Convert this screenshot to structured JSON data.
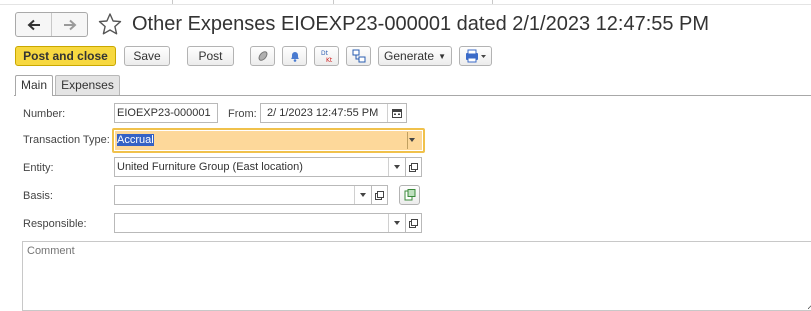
{
  "window": {
    "title": "Other Expenses EIOEXP23-000001 dated 2/1/2023 12:47:55 PM"
  },
  "nav": {
    "back_icon": "arrow-left-icon",
    "forward_icon": "arrow-right-icon",
    "favorite_icon": "star-icon"
  },
  "toolbar": {
    "post_close_label": "Post and close",
    "save_label": "Save",
    "post_label": "Post",
    "generate_label": "Generate",
    "icons": [
      "paperclip-icon",
      "bell-icon",
      "debit-credit-icon",
      "structure-icon",
      "print-icon"
    ],
    "accent_color": "#f7d840"
  },
  "tabs": [
    {
      "label": "Main",
      "active": true
    },
    {
      "label": "Expenses",
      "active": false
    }
  ],
  "form": {
    "number_label": "Number:",
    "number_value": "EIOEXP23-000001",
    "from_label": "From:",
    "from_value": "2/ 1/2023 12:47:55 PM",
    "transaction_type_label": "Transaction Type:",
    "transaction_type_value": "Accrual",
    "entity_label": "Entity:",
    "entity_value": "United Furniture Group (East location)",
    "basis_label": "Basis:",
    "basis_value": "",
    "responsible_label": "Responsible:",
    "responsible_value": "",
    "comment_placeholder": "Comment",
    "focus_color": "#f0c14b",
    "selection_color": "#3461c5"
  }
}
